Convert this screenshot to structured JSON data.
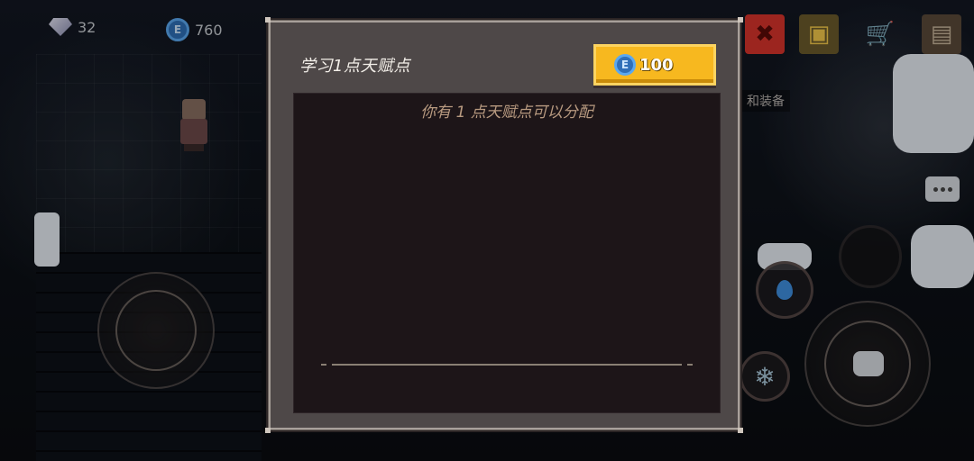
{
  "hud": {
    "gems": "32",
    "coins": "760"
  },
  "background": {
    "side_label": "和装备"
  },
  "dialog": {
    "title": "学习1点天赋点",
    "cost": "100",
    "info": "你有 1 点天赋点可以分配"
  },
  "icons": {
    "gem": "gem-icon",
    "coin": "coin-icon",
    "close": "close-icon",
    "chest": "chest-icon",
    "cart": "shopping-cart-icon",
    "journal": "journal-icon",
    "chat": "chat-bubble-icon",
    "water": "water-drop-skill-icon",
    "snowflake": "snowflake-skill-icon",
    "emote": "emote-icon"
  },
  "colors": {
    "gold_button": "#f7b81f",
    "coin_blue": "#2f6fb8",
    "close_red": "#d9342b",
    "info_text": "#b89a80"
  }
}
